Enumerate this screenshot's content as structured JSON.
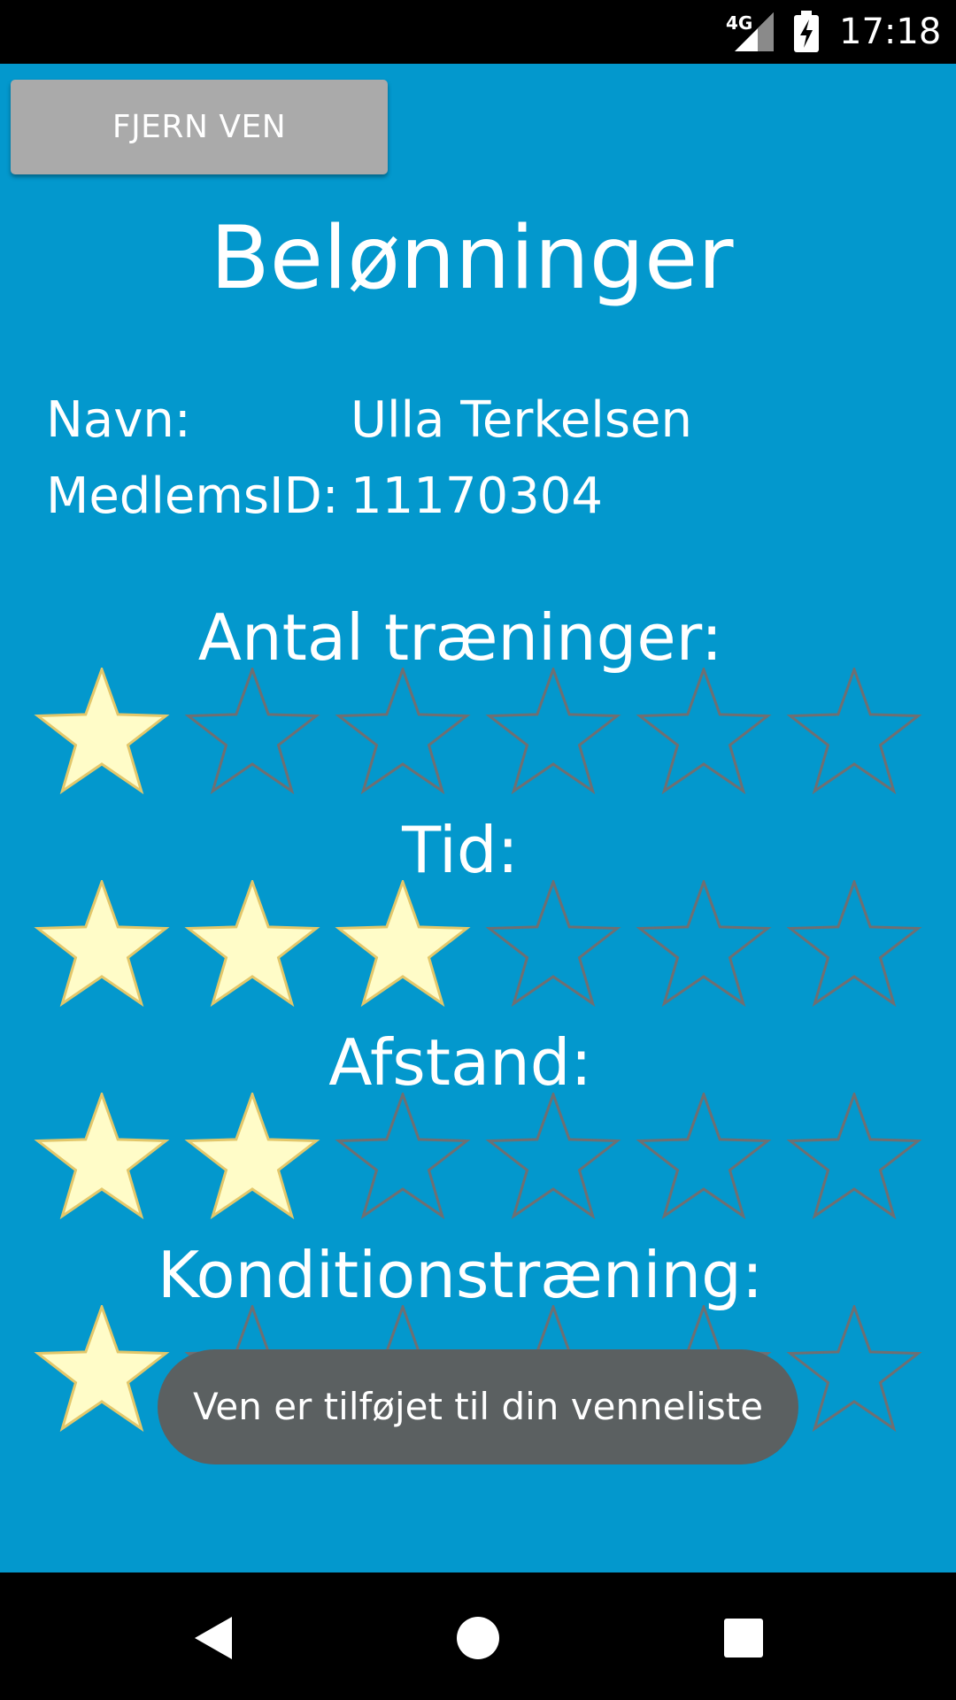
{
  "status_bar": {
    "network": "4G",
    "time": "17:18",
    "icons": [
      "signal-icon",
      "battery-charging-icon"
    ]
  },
  "toolbar": {
    "remove_friend_label": "FJERN VEN"
  },
  "page": {
    "title": "Belønninger"
  },
  "profile": {
    "name_label": "Navn:",
    "name_value": "Ulla Terkelsen",
    "member_id_label": "MedlemsID:",
    "member_id_value": "11170304"
  },
  "rewards": {
    "max_stars": 6,
    "filled_color": "#fffcc8",
    "filled_stroke": "#e3c76a",
    "empty_stroke": "#6f6f72",
    "sections": [
      {
        "title": "Antal træninger:",
        "rating": 1
      },
      {
        "title": "Tid:",
        "rating": 3
      },
      {
        "title": "Afstand:",
        "rating": 2
      },
      {
        "title": "Konditionstræning:",
        "rating": 1
      }
    ]
  },
  "toast": {
    "message": "Ven er tilføjet til din venneliste"
  },
  "nav_bar": {
    "icons": [
      "back-icon",
      "home-icon",
      "recents-icon"
    ]
  },
  "colors": {
    "background": "#0398cd",
    "button_gray": "#aaaaaa",
    "toast_bg": "#5b6061",
    "system_bars": "#000000"
  }
}
